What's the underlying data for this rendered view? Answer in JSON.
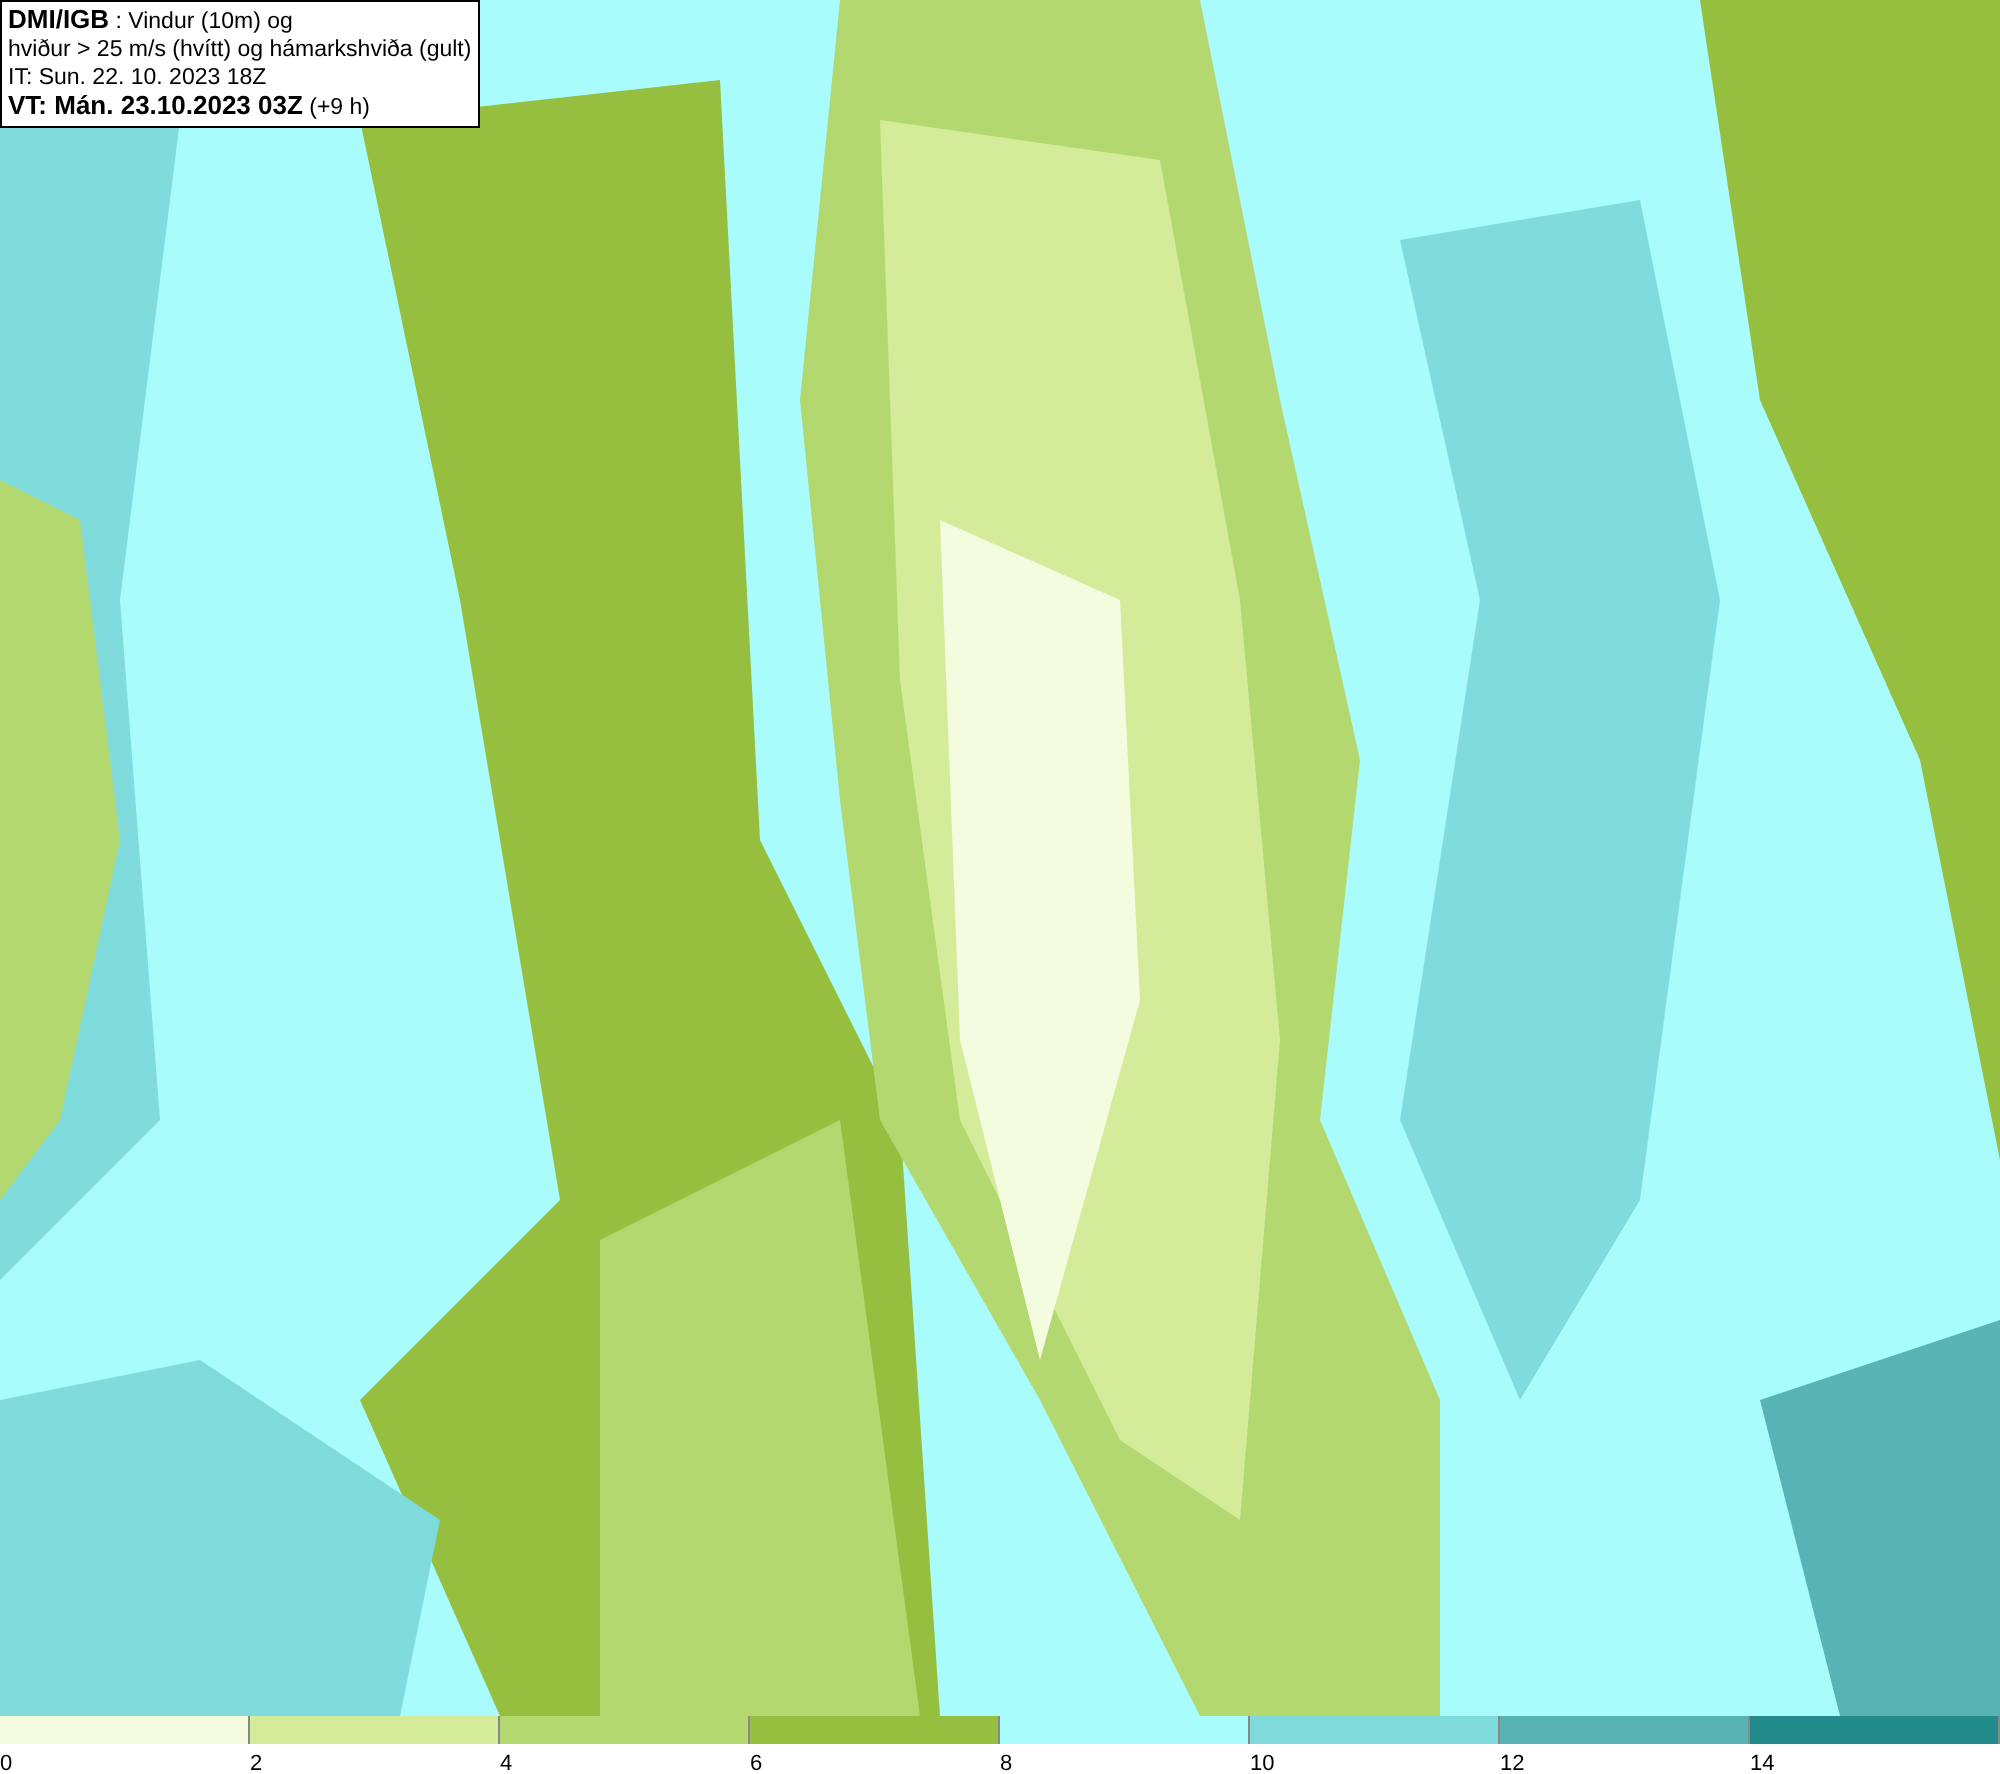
{
  "title_box": {
    "lines": [
      "**DMI/IGB** : Vindur (10m) og",
      "hviður > 25 m/s (hvítt) og hámarkshviða (gult)",
      "IT: Sun. 22. 10. 2023 18Z",
      "**VT: Mán. 23.10.2023 03Z** (+9 h)"
    ]
  },
  "legend": {
    "bins": [
      {
        "label": "0",
        "color": "#f4fce0"
      },
      {
        "label": "2",
        "color": "#d4eb9a"
      },
      {
        "label": "4",
        "color": "#b4d870"
      },
      {
        "label": "6",
        "color": "#96bf40"
      },
      {
        "label": "8",
        "color": "#a8fcfc"
      },
      {
        "label": "10",
        "color": "#80dcdc"
      },
      {
        "label": "12",
        "color": "#58b4b4"
      },
      {
        "label": "14",
        "color": "#228c8c"
      }
    ]
  }
}
